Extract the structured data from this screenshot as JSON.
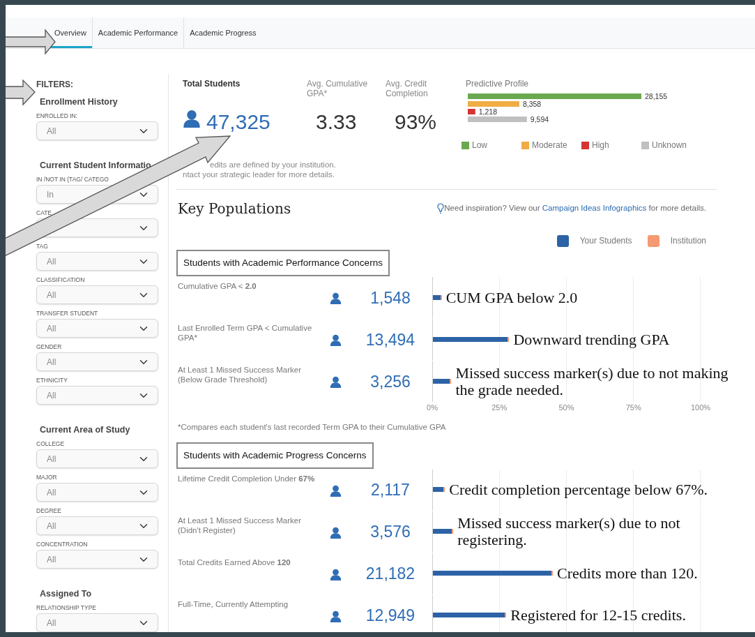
{
  "tabs": [
    {
      "label": "Overview",
      "selected": true
    },
    {
      "label": "Academic Performance",
      "selected": false
    },
    {
      "label": "Academic Progress",
      "selected": false
    }
  ],
  "filters": {
    "title": "FILTERS:",
    "sections": [
      {
        "title": "Enrollment History",
        "fields": [
          {
            "label": "ENROLLED IN:",
            "value": "All"
          }
        ]
      },
      {
        "title": "Current Student Informatio",
        "fields": [
          {
            "label": "IN /NOT IN (TAG/ CATEGO",
            "value": "In"
          },
          {
            "label": "CATE"
          },
          {
            "label": "TAG",
            "value": "All"
          },
          {
            "label": "CLASSIFICATION",
            "value": "All"
          },
          {
            "label": "TRANSFER STUDENT",
            "value": "All"
          },
          {
            "label": "GENDER",
            "value": "All"
          },
          {
            "label": "ETHNICITY",
            "value": "All"
          }
        ]
      },
      {
        "title": "Current Area of Study",
        "fields": [
          {
            "label": "COLLEGE",
            "value": "All"
          },
          {
            "label": "MAJOR",
            "value": "All"
          },
          {
            "label": "DEGREE",
            "value": "All"
          },
          {
            "label": "CONCENTRATION",
            "value": "All"
          }
        ]
      },
      {
        "title": "Assigned To",
        "fields": [
          {
            "label": "RELATIONSHIP TYPE",
            "value": "All"
          }
        ]
      }
    ]
  },
  "stats": [
    {
      "kind": "count",
      "label": "Total Students",
      "value": "47,325"
    },
    {
      "kind": "plain",
      "label": "Avg. Cumulative GPA*",
      "value": "3.33"
    },
    {
      "kind": "plain",
      "label": "Avg. Credit Completion",
      "value": "93%"
    }
  ],
  "predictive_profile": {
    "title": "Predictive Profile",
    "chart_data": {
      "type": "bar",
      "orientation": "horizontal",
      "series": [
        {
          "name": "Low",
          "color": "#6aa84f",
          "values": [
            28155
          ],
          "value_labels": [
            "28,155"
          ]
        },
        {
          "name": "Moderate",
          "color": "#f0ad44",
          "values": [
            8358
          ],
          "value_labels": [
            "8,358"
          ]
        },
        {
          "name": "High",
          "color": "#d63333",
          "values": [
            1218
          ],
          "value_labels": [
            "1,218"
          ]
        },
        {
          "name": "Unknown",
          "color": "#c0c0c0",
          "values": [
            9594
          ],
          "value_labels": [
            "9,594"
          ]
        }
      ]
    }
  },
  "stats_note": [
    "edits are defined by your institution.",
    "ntact your strategic leader for more details."
  ],
  "key_populations": {
    "title": "Key Populations",
    "inspiration": {
      "before": "Need inspiration? View our ",
      "link": "Campaign Ideas Infographics",
      "after": " for more details."
    },
    "legend": [
      {
        "label": "Your Students",
        "color": "#2d63a6"
      },
      {
        "label": "Institution",
        "color": "#f59a72"
      }
    ],
    "groups": [
      {
        "title": "Students with Academic Performance Concerns",
        "rows": [
          {
            "label": "Cumulative GPA < **2.0**",
            "count": "1,548",
            "level": 0.033,
            "annotation": "CUM GPA below 2.0"
          },
          {
            "label": "Last Enrolled Term GPA < Cumulative GPA*",
            "count": "13,494",
            "level": 0.285,
            "annotation": "Downward trending GPA"
          },
          {
            "label": "At Least 1 Missed Success Marker (Below Grade Threshold)",
            "count": "3,256",
            "level": 0.069,
            "annotation": "Missed success marker(s) due to not making the grade needed."
          }
        ],
        "axis_ticks": [
          "0%",
          "25%",
          "50%",
          "75%",
          "100%"
        ],
        "footnote": "*Compares each student's last recorded Term GPA to their Cumulative GPA"
      },
      {
        "title": "Students with Academic Progress Concerns",
        "rows": [
          {
            "label": "Lifetime Credit Completion Under **67%**",
            "count": "2,117",
            "level": 0.045,
            "annotation": "Credit completion percentage below 67%."
          },
          {
            "label": "At Least 1 Missed Success Marker (Didn't Register)",
            "count": "3,576",
            "level": 0.076,
            "annotation": "Missed success marker(s) due to not registering."
          },
          {
            "label": "Total Credits Earned Above **120**",
            "count": "21,182",
            "level": 0.448,
            "annotation": "Credits more than 120."
          },
          {
            "label": "Full-Time, Currently Attempting",
            "count": "12,949",
            "level": 0.274,
            "annotation": "Registered for 12-15 credits."
          }
        ]
      }
    ]
  }
}
